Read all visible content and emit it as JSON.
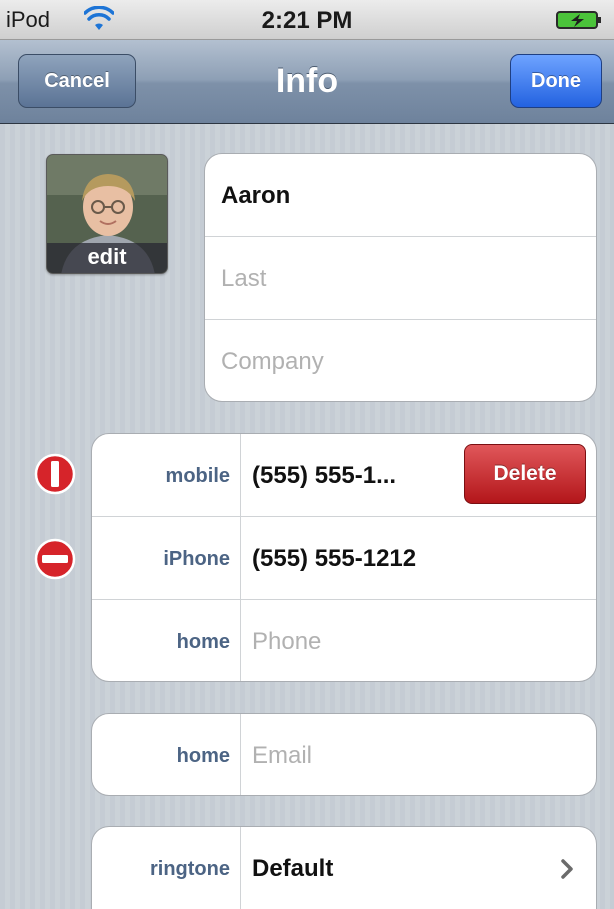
{
  "status_bar": {
    "carrier": "iPod",
    "time": "2:21 PM",
    "icons": [
      "wifi-icon",
      "battery-charging-icon"
    ]
  },
  "nav_bar": {
    "title": "Info",
    "cancel_label": "Cancel",
    "done_label": "Done"
  },
  "photo": {
    "edit_label": "edit"
  },
  "name_fields": [
    {
      "value": "Aaron",
      "placeholder": ""
    },
    {
      "value": "",
      "placeholder": "Last"
    },
    {
      "value": "",
      "placeholder": "Company"
    }
  ],
  "phones": [
    {
      "label": "mobile",
      "value": "(555) 555-1...",
      "placeholder": "",
      "delete_label": "Delete",
      "remove_control": "minus-rotated-icon"
    },
    {
      "label": "iPhone",
      "value": "(555) 555-1212",
      "placeholder": "",
      "remove_control": "minus-icon"
    },
    {
      "label": "home",
      "value": "",
      "placeholder": "Phone"
    }
  ],
  "emails": [
    {
      "label": "home",
      "value": "",
      "placeholder": "Email"
    }
  ],
  "ringtone": {
    "label": "ringtone",
    "value": "Default",
    "icon": "chevron-right-icon"
  },
  "colors": {
    "nav_bar": "#7e91a9",
    "done_button": "#2362e0",
    "delete_button": "#b3161a",
    "field_label": "#4c6484",
    "placeholder": "#b1b1b1",
    "background": "#c5ccd4"
  }
}
